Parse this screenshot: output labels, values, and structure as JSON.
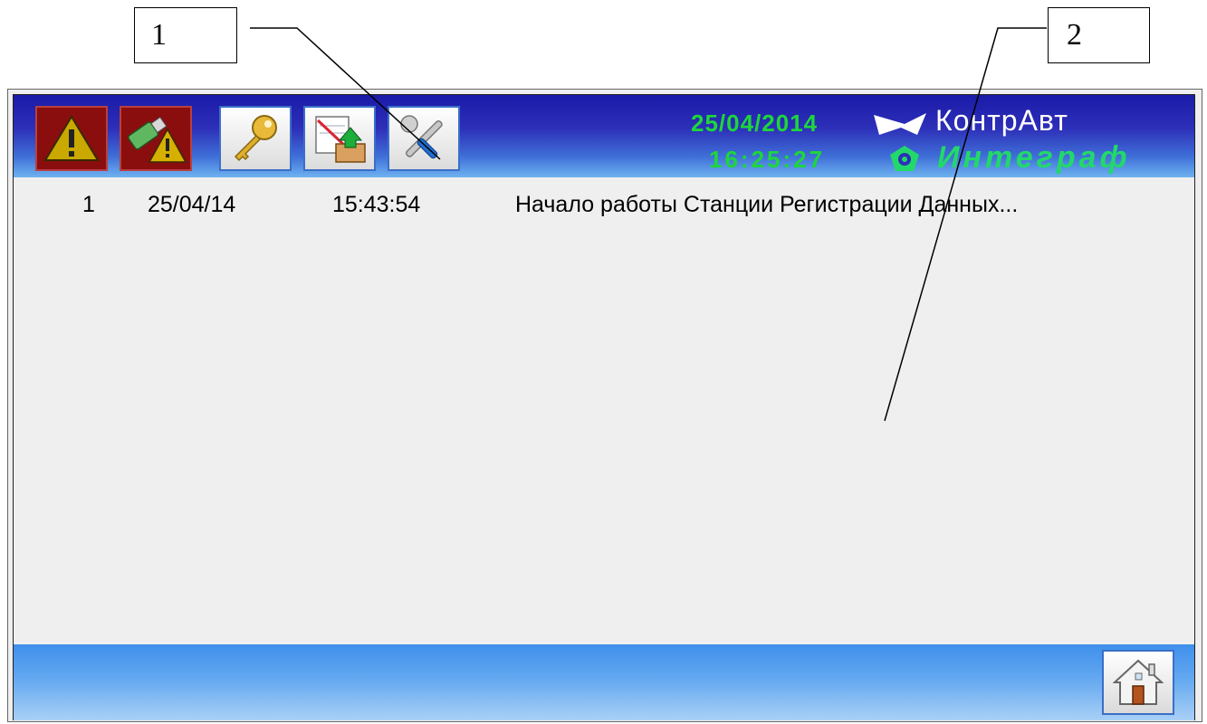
{
  "callouts": {
    "first": "1",
    "second": "2"
  },
  "toolbar": {
    "buttons": [
      {
        "icon": "alarm-warning-icon"
      },
      {
        "icon": "usb-warning-icon"
      },
      {
        "icon": "key-icon"
      },
      {
        "icon": "export-notes-icon"
      },
      {
        "icon": "settings-wrench-icon"
      }
    ]
  },
  "header": {
    "date": "25/04/2014",
    "time": "16:25:27",
    "logo_brand": "КонтрАвт",
    "logo_product": "Интеграф"
  },
  "log": {
    "rows": [
      {
        "index": "1",
        "date": "25/04/14",
        "time": "15:43:54",
        "message": "Начало работы Станции Регистрации Данных..."
      }
    ]
  },
  "footer": {
    "home_icon": "home-icon"
  },
  "colors": {
    "header_blue": "#2d2fb8",
    "clock_green": "#1dd63b",
    "alarm_red": "#8a0e0e"
  }
}
